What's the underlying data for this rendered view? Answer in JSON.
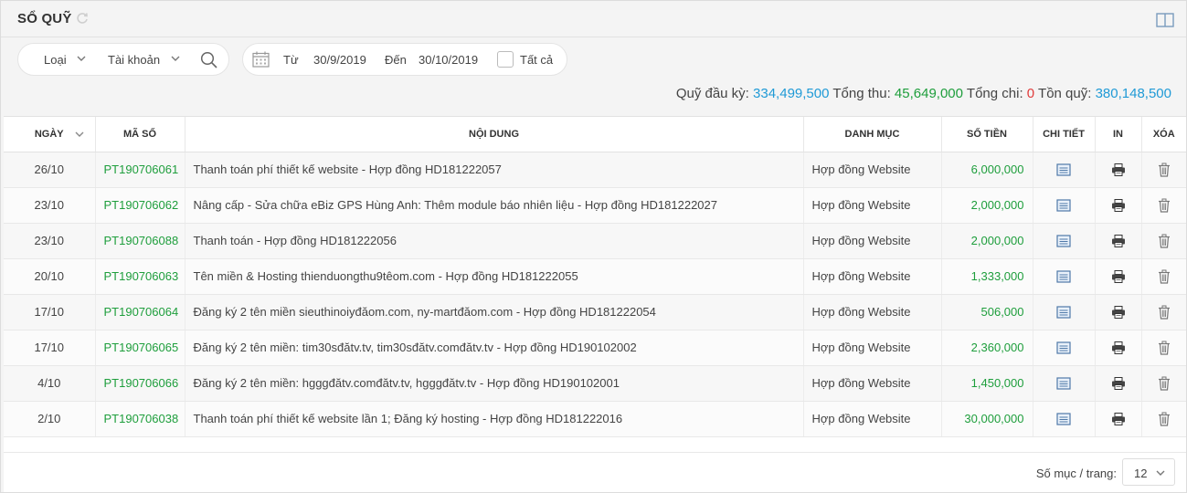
{
  "header": {
    "title": "SỔ QUỸ"
  },
  "filters": {
    "type_label": "Loại",
    "account_label": "Tài khoản",
    "from_label": "Từ",
    "from_value": "30/9/2019",
    "to_label": "Đến",
    "to_value": "30/10/2019",
    "all_label": "Tất cả"
  },
  "summary": {
    "opening_label": "Quỹ đầu kỳ:",
    "opening_value": "334,499,500",
    "income_label": "Tổng thu:",
    "income_value": "45,649,000",
    "expense_label": "Tổng chi:",
    "expense_value": "0",
    "balance_label": "Tồn quỹ:",
    "balance_value": "380,148,500"
  },
  "table": {
    "columns": [
      "NGÀY",
      "MÃ SỐ",
      "NỘI DUNG",
      "DANH MỤC",
      "SỐ TIỀN",
      "CHI TIẾT",
      "IN",
      "XÓA"
    ],
    "rows": [
      {
        "date": "26/10",
        "code": "PT190706061",
        "content": "Thanh toán phí thiết kế website - Hợp đồng HD181222057",
        "category": "Hợp đồng Website",
        "amount": "6,000,000"
      },
      {
        "date": "23/10",
        "code": "PT190706062",
        "content": "Nâng cấp - Sửa chữa eBiz GPS Hùng Anh: Thêm module báo nhiên liệu - Hợp đồng HD181222027",
        "category": "Hợp đồng Website",
        "amount": "2,000,000"
      },
      {
        "date": "23/10",
        "code": "PT190706088",
        "content": "Thanh toán - Hợp đồng HD181222056",
        "category": "Hợp đồng Website",
        "amount": "2,000,000"
      },
      {
        "date": "20/10",
        "code": "PT190706063",
        "content": "Tên miền & Hosting thienduongthu9têom.com - Hợp đồng HD181222055",
        "category": "Hợp đồng Website",
        "amount": "1,333,000"
      },
      {
        "date": "17/10",
        "code": "PT190706064",
        "content": "Đăng ký 2 tên miền sieuthinoiyđăom.com, ny-martđăom.com - Hợp đồng HD181222054",
        "category": "Hợp đồng Website",
        "amount": "506,000"
      },
      {
        "date": "17/10",
        "code": "PT190706065",
        "content": "Đăng ký 2 tên miền: tim30sđătv.tv, tim30sđătv.comđătv.tv - Hợp đồng HD190102002",
        "category": "Hợp đồng Website",
        "amount": "2,360,000"
      },
      {
        "date": "4/10",
        "code": "PT190706066",
        "content": "Đăng ký 2 tên miền: hgggđătv.comđătv.tv, hgggđătv.tv - Hợp đồng HD190102001",
        "category": "Hợp đồng Website",
        "amount": "1,450,000"
      },
      {
        "date": "2/10",
        "code": "PT190706038",
        "content": "Thanh toán phí thiết kế website lần 1; Đăng ký hosting - Hợp đồng HD181222016",
        "category": "Hợp đồng Website",
        "amount": "30,000,000"
      }
    ]
  },
  "pagination": {
    "per_page_label": "Số mục / trang:",
    "per_page_value": "12"
  },
  "icons": {
    "refresh": "refresh-icon",
    "book": "book-icon",
    "search": "search-icon",
    "calendar": "calendar-icon",
    "detail": "list-detail-icon",
    "print": "printer-icon",
    "delete": "trash-icon"
  },
  "colors": {
    "accent_blue": "#1f9ad6",
    "income_green": "#1e9e3c",
    "expense_red": "#e03b3b"
  }
}
